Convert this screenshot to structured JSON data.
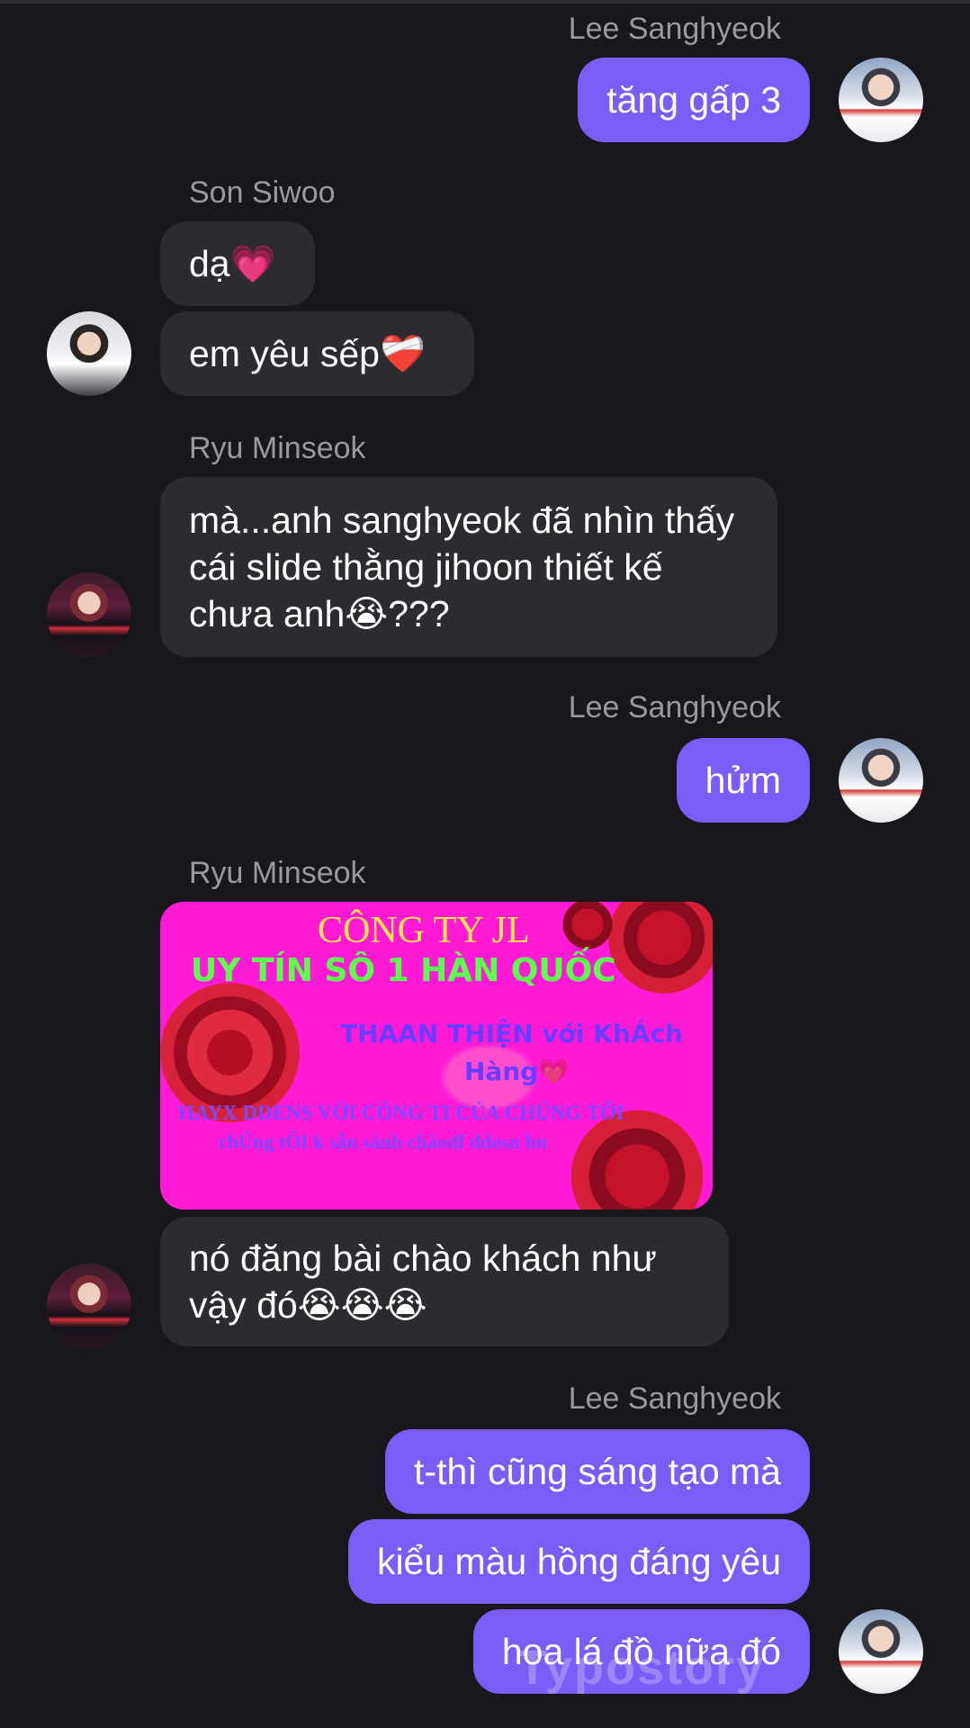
{
  "messages": {
    "m1_sender": "Lee Sanghyeok",
    "m1_text": "tăng gấp 3",
    "m2_sender": "Son Siwoo",
    "m2_text1": "dạ💗",
    "m2_text2": "em yêu sếp❤️‍🩹",
    "m3_sender": "Ryu Minseok",
    "m3_text": "mà...anh sanghyeok đã nhìn thấy cái slide thằng jihoon thiết kế chưa anh😭???",
    "m4_sender": "Lee Sanghyeok",
    "m4_text": "hửm",
    "m5_sender": "Ryu Minseok",
    "m5_text": "nó đăng bài chào khách như vậy đó😭😭😭",
    "m6_sender": "Lee Sanghyeok",
    "m6_text1": "t-thì cũng sáng tạo mà",
    "m6_text2": "kiểu màu hồng đáng yêu",
    "m6_text3": "hoa lá đồ nữa đó"
  },
  "slide": {
    "line1": "CÔNG TY JL",
    "line2": "UY TÍN SÔ 1 HÀN QUỐC",
    "line3": "THAAN THIỆN với KhÁch",
    "line4": "Hàng💗",
    "line5": "HAYX DDENS VỚI CÔNG TI CỦA CHÚNG TÔI",
    "line6": "chÚng tÔI k sẵn sành chàodf ddosn bn"
  },
  "watermark": "Typostory",
  "colors": {
    "background": "#18171b",
    "outgoing_bubble": "#7b5cf6",
    "incoming_bubble": "#2c2b30",
    "name_text": "#9a99a0",
    "slide_background": "#ff1ad6"
  }
}
